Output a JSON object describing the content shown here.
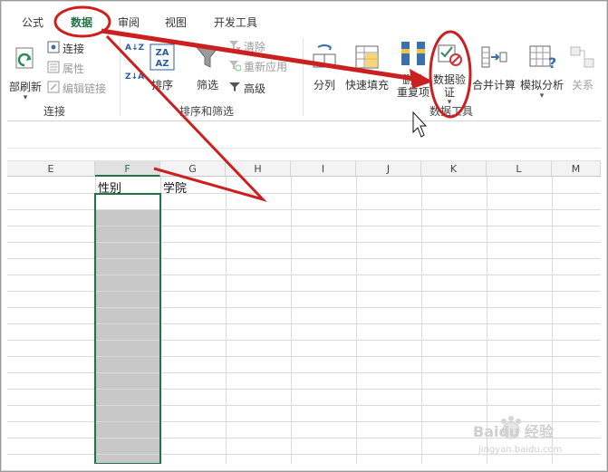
{
  "tabs": [
    {
      "label": "公式",
      "active": false
    },
    {
      "label": "数据",
      "active": true
    },
    {
      "label": "审阅",
      "active": false
    },
    {
      "label": "视图",
      "active": false
    },
    {
      "label": "开发工具",
      "active": false
    }
  ],
  "ribbon": {
    "connections": {
      "group_label": "连接",
      "refresh_all": "部刷新",
      "connect": "连接",
      "properties": "属性",
      "edit_links": "编辑链接"
    },
    "sort_filter": {
      "group_label": "排序和筛选",
      "sort": "排序",
      "filter": "筛选",
      "clear": "清除",
      "reapply": "重新应用",
      "advanced": "高级"
    },
    "data_tools": {
      "group_label": "数据工具",
      "text_to_columns": "分列",
      "flash_fill": "快速填充",
      "remove_dup_line1": "删除",
      "remove_dup_line2": "重复项",
      "data_validation_line1": "数据验",
      "data_validation_line2": "证",
      "consolidate": "合并计算",
      "what_if": "模拟分析",
      "relationships": "关系"
    },
    "sort_icon_top": "A↓Z",
    "sort_icon_bottom": "Z↓A",
    "sort_big_top": "ZA",
    "sort_big_bottom": "AZ"
  },
  "grid": {
    "columns": [
      "E",
      "F",
      "G",
      "H",
      "I",
      "J",
      "K",
      "L",
      "M"
    ],
    "selected_column": "F",
    "cells": {
      "F1": "性别",
      "G1": "学院"
    }
  },
  "annotation_colors": {
    "arrow": "#cc1f1f",
    "accent": "#217346"
  },
  "watermark": {
    "brand": "Baidu 经验",
    "url": "jingyan.baidu.com"
  }
}
